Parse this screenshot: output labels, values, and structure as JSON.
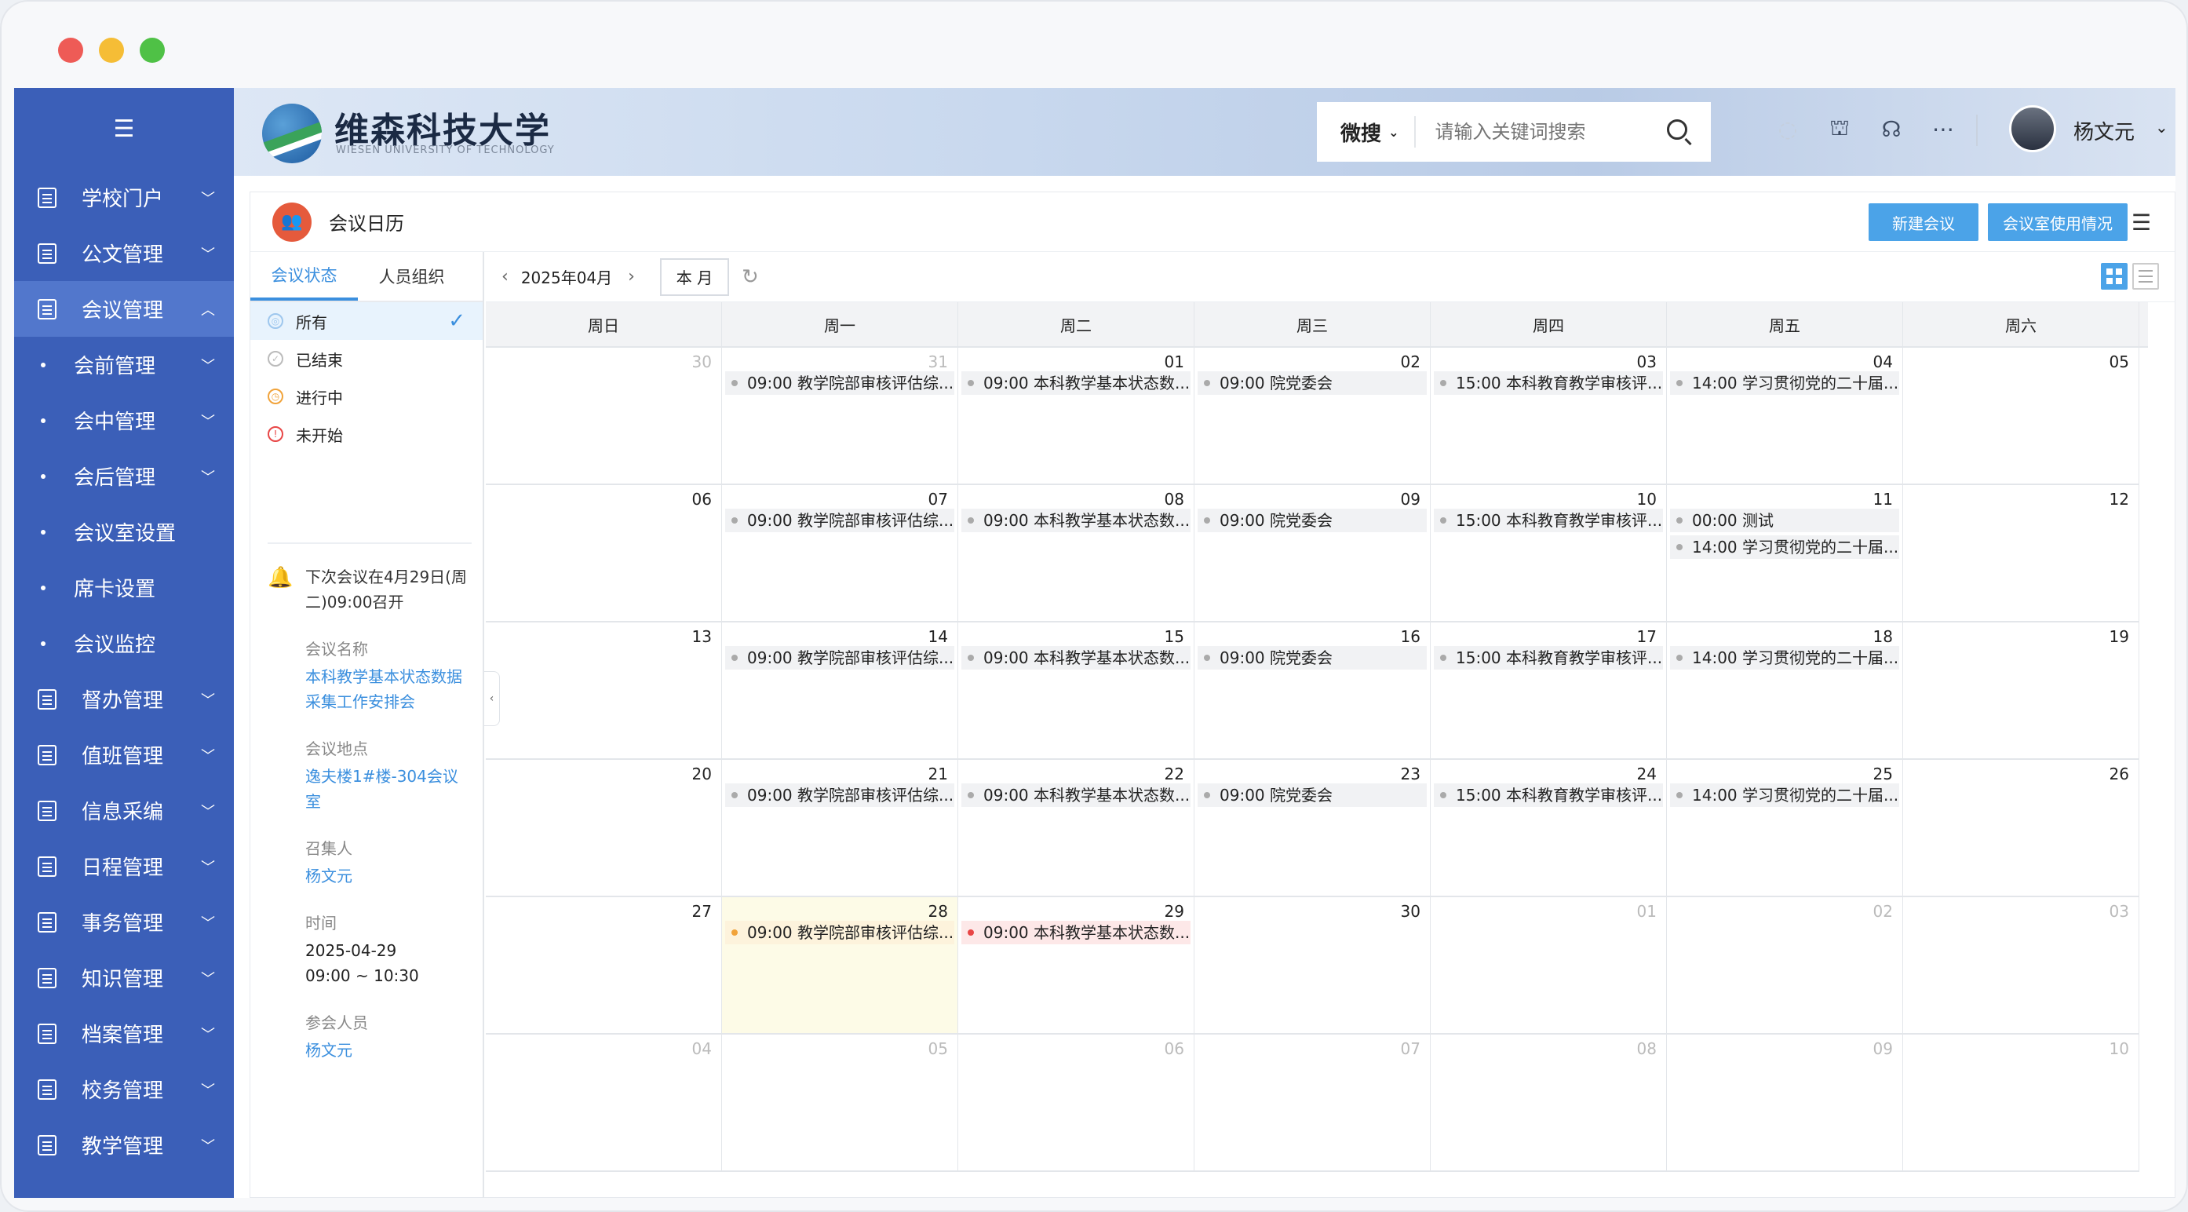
{
  "colors": {
    "sidebar": "#3b5fb8",
    "accent": "#4ba3e8",
    "active_sub": "#5277cc",
    "today": "#fdfbe7"
  },
  "sidebar": {
    "toggle_icon": "indent-icon",
    "items": [
      {
        "label": "学校门户",
        "icon": "doc-icon"
      },
      {
        "label": "公文管理",
        "icon": "doc-icon"
      },
      {
        "label": "会议管理",
        "icon": "doc-icon",
        "active": true,
        "expanded": true
      }
    ],
    "subitems": [
      {
        "label": "会前管理",
        "has_chevron": true
      },
      {
        "label": "会中管理",
        "has_chevron": true
      },
      {
        "label": "会后管理",
        "has_chevron": true
      },
      {
        "label": "会议室设置"
      },
      {
        "label": "席卡设置"
      },
      {
        "label": "会议监控"
      }
    ],
    "items2": [
      {
        "label": "督办管理",
        "icon": "doc-icon"
      },
      {
        "label": "值班管理",
        "icon": "doc-icon"
      },
      {
        "label": "信息采编",
        "icon": "bank-icon"
      },
      {
        "label": "日程管理",
        "icon": "calendar-icon"
      },
      {
        "label": "事务管理",
        "icon": "doc-icon"
      },
      {
        "label": "知识管理",
        "icon": "doc-icon"
      },
      {
        "label": "档案管理",
        "icon": "doc-icon"
      },
      {
        "label": "校务管理",
        "icon": "doc-icon"
      },
      {
        "label": "教学管理",
        "icon": "doc-icon"
      }
    ]
  },
  "header": {
    "school_name": "维森科技大学",
    "school_name_en": "WIESEN UNIVERSITY OF TECHNOLOGY",
    "search_scope": "微搜",
    "search_placeholder": "请输入关键词搜索",
    "user_name": "杨文元"
  },
  "page": {
    "title": "会议日历",
    "btn_new": "新建会议",
    "btn_room": "会议室使用情况"
  },
  "left": {
    "tabs": [
      "会议状态",
      "人员组织"
    ],
    "statuses": [
      {
        "label": "所有",
        "active": true
      },
      {
        "label": "已结束"
      },
      {
        "label": "进行中"
      },
      {
        "label": "未开始"
      }
    ],
    "next_meeting": "下次会议在4月29日(周二)09:00召开",
    "name_label": "会议名称",
    "name_value": "本科教学基本状态数据采集工作安排会",
    "place_label": "会议地点",
    "place_value": "逸夫楼1#楼-304会议室",
    "host_label": "召集人",
    "host_value": "杨文元",
    "time_label": "时间",
    "time_date": "2025-04-29",
    "time_range": "09:00 ~ 10:30",
    "attendees_label": "参会人员",
    "attendees_value": "杨文元"
  },
  "calendar": {
    "month": "2025年04月",
    "today_btn": "本 月",
    "weekdays": [
      "周日",
      "周一",
      "周二",
      "周三",
      "周四",
      "周五",
      "周六"
    ],
    "weeks": [
      [
        {
          "d": "30",
          "dim": true
        },
        {
          "d": "31",
          "dim": true,
          "ev": [
            {
              "t": "09:00 教学院部审核评估综..."
            }
          ]
        },
        {
          "d": "01",
          "ev": [
            {
              "t": "09:00 本科教学基本状态数..."
            }
          ]
        },
        {
          "d": "02",
          "ev": [
            {
              "t": "09:00 院党委会"
            }
          ]
        },
        {
          "d": "03",
          "ev": [
            {
              "t": "15:00 本科教育教学审核评..."
            }
          ]
        },
        {
          "d": "04",
          "ev": [
            {
              "t": "14:00 学习贯彻党的二十届..."
            }
          ]
        },
        {
          "d": "05"
        }
      ],
      [
        {
          "d": "06"
        },
        {
          "d": "07",
          "ev": [
            {
              "t": "09:00 教学院部审核评估综..."
            }
          ]
        },
        {
          "d": "08",
          "ev": [
            {
              "t": "09:00 本科教学基本状态数..."
            }
          ]
        },
        {
          "d": "09",
          "ev": [
            {
              "t": "09:00 院党委会"
            }
          ]
        },
        {
          "d": "10",
          "ev": [
            {
              "t": "15:00 本科教育教学审核评..."
            }
          ]
        },
        {
          "d": "11",
          "ev": [
            {
              "t": "00:00 测试"
            },
            {
              "t": "14:00 学习贯彻党的二十届..."
            }
          ]
        },
        {
          "d": "12"
        }
      ],
      [
        {
          "d": "13"
        },
        {
          "d": "14",
          "ev": [
            {
              "t": "09:00 教学院部审核评估综..."
            }
          ]
        },
        {
          "d": "15",
          "ev": [
            {
              "t": "09:00 本科教学基本状态数..."
            }
          ]
        },
        {
          "d": "16",
          "ev": [
            {
              "t": "09:00 院党委会"
            }
          ]
        },
        {
          "d": "17",
          "ev": [
            {
              "t": "15:00 本科教育教学审核评..."
            }
          ]
        },
        {
          "d": "18",
          "ev": [
            {
              "t": "14:00 学习贯彻党的二十届..."
            }
          ]
        },
        {
          "d": "19"
        }
      ],
      [
        {
          "d": "20"
        },
        {
          "d": "21",
          "ev": [
            {
              "t": "09:00 教学院部审核评估综..."
            }
          ]
        },
        {
          "d": "22",
          "ev": [
            {
              "t": "09:00 本科教学基本状态数..."
            }
          ]
        },
        {
          "d": "23",
          "ev": [
            {
              "t": "09:00 院党委会"
            }
          ]
        },
        {
          "d": "24",
          "ev": [
            {
              "t": "15:00 本科教育教学审核评..."
            }
          ]
        },
        {
          "d": "25",
          "ev": [
            {
              "t": "14:00 学习贯彻党的二十届..."
            }
          ]
        },
        {
          "d": "26"
        }
      ],
      [
        {
          "d": "27"
        },
        {
          "d": "28",
          "today": true,
          "ev": [
            {
              "t": "09:00 教学院部审核评估综...",
              "c": "orange"
            }
          ]
        },
        {
          "d": "29",
          "ev": [
            {
              "t": "09:00 本科教学基本状态数...",
              "c": "red"
            }
          ]
        },
        {
          "d": "30"
        },
        {
          "d": "01",
          "dim": true
        },
        {
          "d": "02",
          "dim": true
        },
        {
          "d": "03",
          "dim": true
        }
      ],
      [
        {
          "d": "04",
          "dim": true
        },
        {
          "d": "05",
          "dim": true
        },
        {
          "d": "06",
          "dim": true
        },
        {
          "d": "07",
          "dim": true
        },
        {
          "d": "08",
          "dim": true
        },
        {
          "d": "09",
          "dim": true
        },
        {
          "d": "10",
          "dim": true
        }
      ]
    ]
  }
}
